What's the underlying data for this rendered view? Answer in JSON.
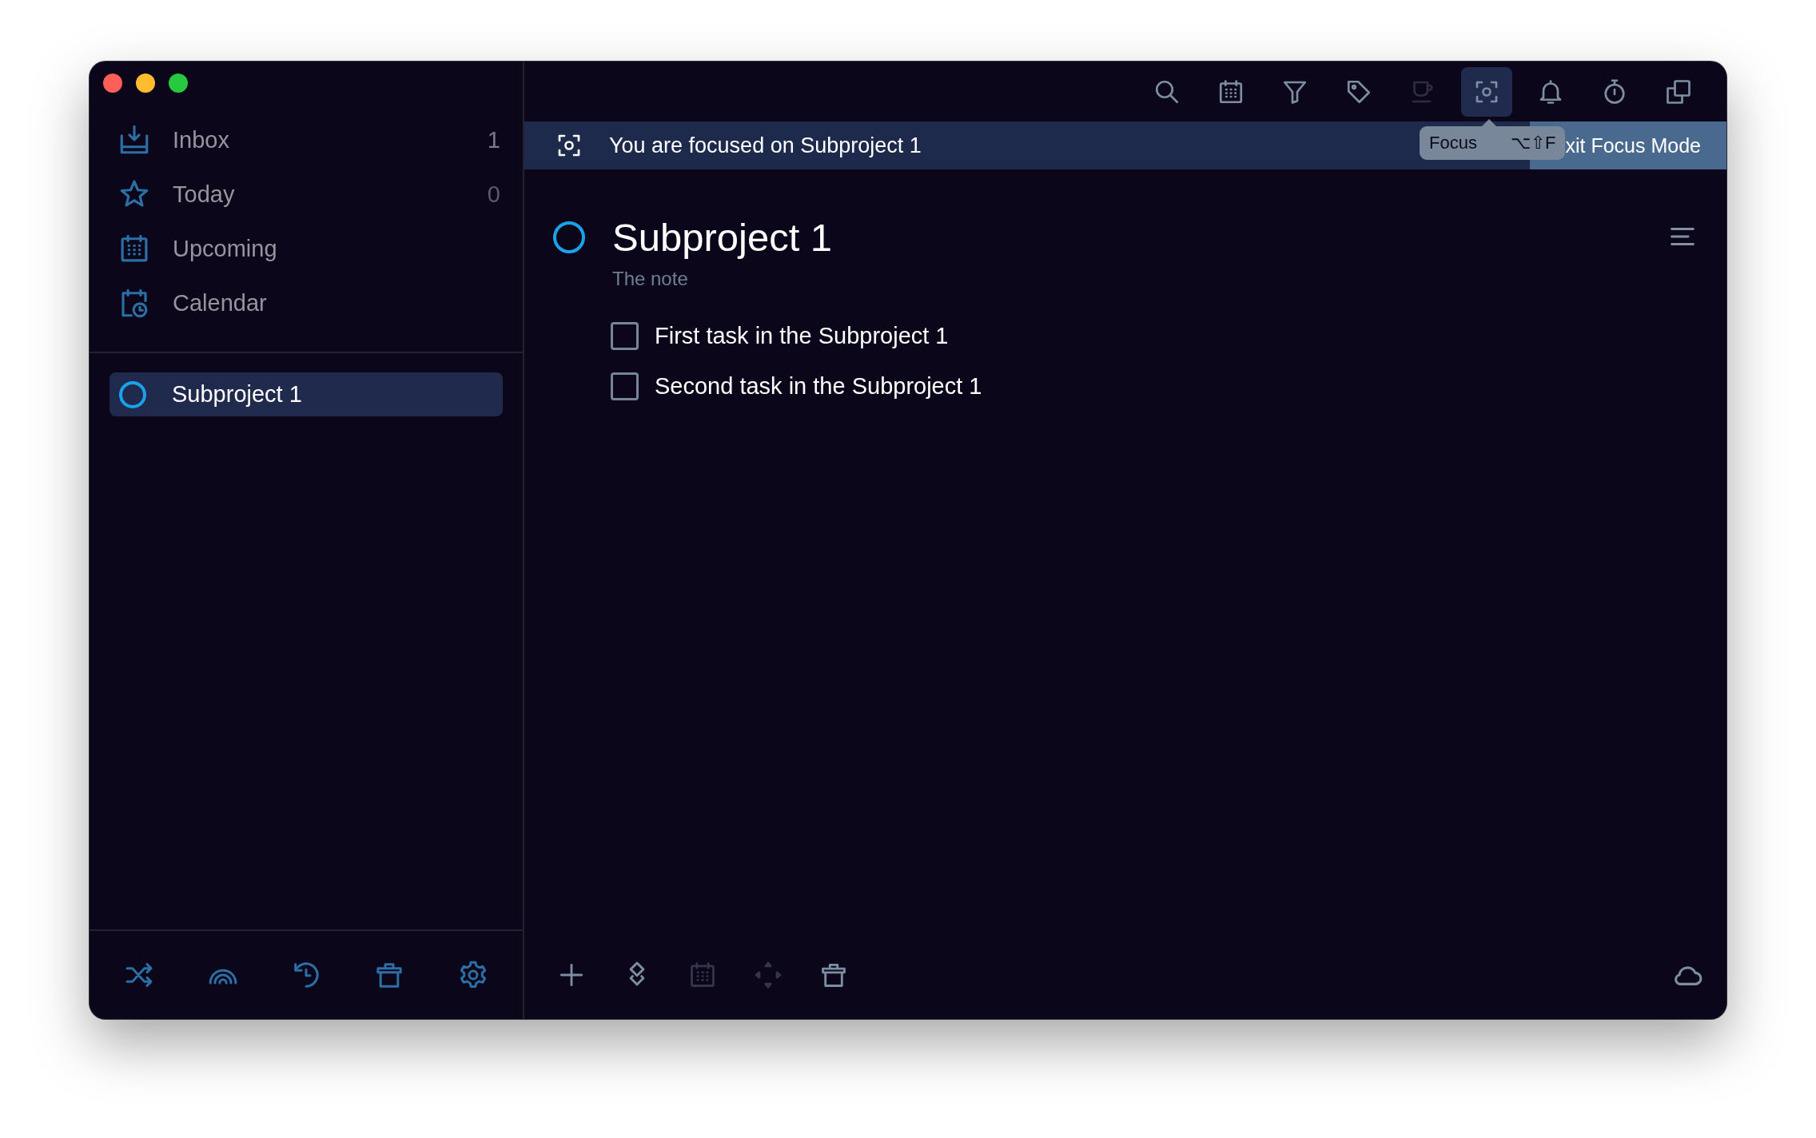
{
  "sidebar": {
    "items": [
      {
        "kind": "inbox",
        "label": "Inbox",
        "count": "1"
      },
      {
        "kind": "star",
        "label": "Today",
        "count": "0"
      },
      {
        "kind": "upcoming",
        "label": "Upcoming"
      },
      {
        "kind": "calendar-clock",
        "label": "Calendar"
      }
    ],
    "projects": [
      {
        "label": "Subproject 1",
        "selected": true
      }
    ],
    "footer_tools": [
      {
        "kind": "shuffle"
      },
      {
        "kind": "rainbow"
      },
      {
        "kind": "history"
      },
      {
        "kind": "trash"
      },
      {
        "kind": "gear"
      }
    ]
  },
  "toolbar": [
    {
      "kind": "search",
      "selected": false,
      "disabled": false
    },
    {
      "kind": "calendar",
      "selected": false,
      "disabled": false
    },
    {
      "kind": "filter",
      "selected": false,
      "disabled": false
    },
    {
      "kind": "tag",
      "selected": false,
      "disabled": false
    },
    {
      "kind": "coffee",
      "selected": false,
      "disabled": true
    },
    {
      "kind": "focus",
      "selected": true,
      "disabled": false
    },
    {
      "kind": "bell",
      "selected": false,
      "disabled": false
    },
    {
      "kind": "timer",
      "selected": false,
      "disabled": false
    },
    {
      "kind": "copy",
      "selected": false,
      "disabled": false
    }
  ],
  "tooltip": {
    "label": "Focus",
    "shortcut": "⌥⇧F"
  },
  "focus_banner": {
    "text": "You are focused on Subproject 1",
    "exit_button": "xit Focus Mode"
  },
  "project": {
    "title": "Subproject 1",
    "note": "The note",
    "tasks": [
      {
        "label": "First task in the Subproject 1",
        "checked": false
      },
      {
        "label": "Second task in the Subproject 1",
        "checked": false
      }
    ]
  },
  "footer_tools": [
    {
      "kind": "plus",
      "disabled": false
    },
    {
      "kind": "diamonds",
      "disabled": false
    },
    {
      "kind": "calendar",
      "disabled": true
    },
    {
      "kind": "move",
      "disabled": true
    },
    {
      "kind": "trash",
      "disabled": false
    }
  ]
}
